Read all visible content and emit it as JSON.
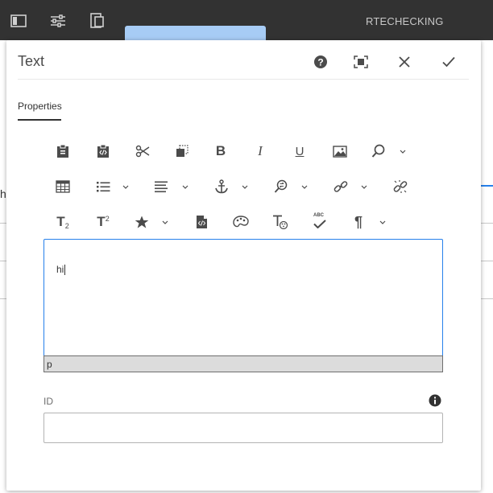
{
  "topbar": {
    "title": "RTECHECKING",
    "icons": [
      "sidebar-toggle-icon",
      "properties-icon",
      "emulator-icon"
    ]
  },
  "background": {
    "partial_text": "h"
  },
  "dialog": {
    "title": "Text",
    "header_actions": [
      "help-icon",
      "fullscreen-icon",
      "close-icon",
      "done-icon"
    ],
    "tabs": [
      {
        "label": "Properties",
        "selected": true
      }
    ],
    "toolbar": {
      "row1": [
        "paste-icon",
        "paste-html-icon",
        "cut-icon",
        "copy-icon",
        "bold-icon",
        "italic-icon",
        "underline-icon",
        "image-icon",
        "find-icon"
      ],
      "row2": [
        "table-icon",
        "list-icon",
        "justify-icon",
        "anchor-icon",
        "find-replace-icon",
        "link-icon",
        "unlink-icon"
      ],
      "row3": [
        "subscript-icon",
        "superscript-icon",
        "special-chars-icon",
        "source-edit-icon",
        "styles-icon",
        "paraformat-icon",
        "spellcheck-icon",
        "paragraph-icon"
      ],
      "labels": {
        "bold": "B",
        "italic": "I",
        "underline": "U",
        "subscript_main": "T",
        "subscript_sub": "2",
        "superscript_main": "T",
        "superscript_sup": "2",
        "spell": "ABC",
        "pilcrow": "¶"
      }
    },
    "editor": {
      "content": "hi",
      "status_path": "p"
    },
    "id_field": {
      "label": "ID",
      "value": "",
      "placeholder": ""
    }
  }
}
